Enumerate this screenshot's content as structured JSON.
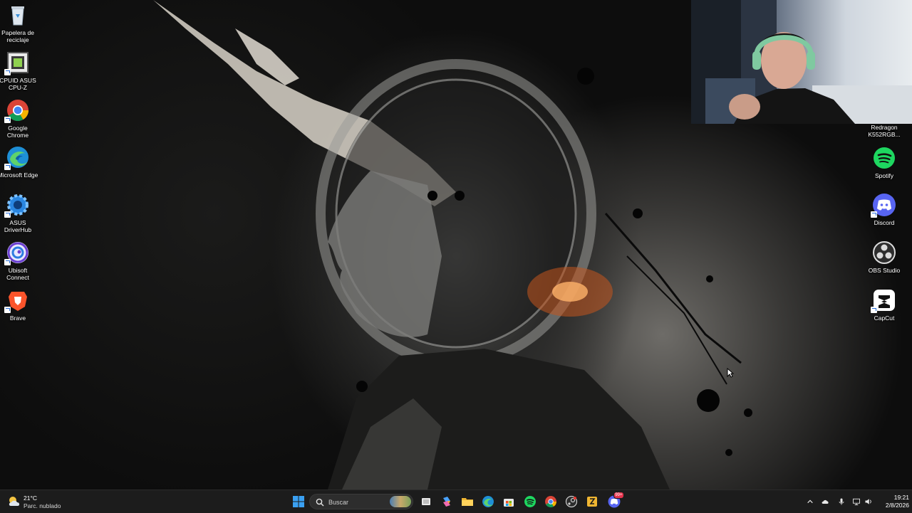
{
  "desktop": {
    "left_icons": [
      {
        "name": "recycle-bin",
        "label": "Papelera de reciclaje",
        "icon": "recycle-bin-icon"
      },
      {
        "name": "cpuz",
        "label": "CPUID ASUS CPU-Z",
        "icon": "cpuz-icon"
      },
      {
        "name": "chrome",
        "label": "Google Chrome",
        "icon": "chrome-icon"
      },
      {
        "name": "edge",
        "label": "Microsoft Edge",
        "icon": "edge-icon"
      },
      {
        "name": "asus-driverhub",
        "label": "ASUS DriverHub",
        "icon": "asus-gear-icon"
      },
      {
        "name": "ubisoft",
        "label": "Ubisoft Connect",
        "icon": "ubisoft-icon"
      },
      {
        "name": "brave",
        "label": "Brave",
        "icon": "brave-lion-icon"
      }
    ],
    "right_icons": [
      {
        "name": "redragon",
        "label": "Redragon K552RGB...",
        "icon": "keyboard-icon"
      },
      {
        "name": "spotify",
        "label": "Spotify",
        "icon": "spotify-icon"
      },
      {
        "name": "discord",
        "label": "Discord",
        "icon": "discord-icon"
      },
      {
        "name": "obs",
        "label": "OBS Studio",
        "icon": "obs-icon"
      },
      {
        "name": "capcut",
        "label": "CapCut",
        "icon": "capcut-icon"
      }
    ]
  },
  "taskbar": {
    "weather": {
      "temp": "21°C",
      "condition": "Parc. nublado",
      "icon": "partly-cloudy-icon"
    },
    "search": {
      "placeholder": "Buscar"
    },
    "pinned": [
      "windows-start-icon",
      "task-view-icon",
      "copilot-icon",
      "file-explorer-icon",
      "edge-icon",
      "microsoft-store-icon",
      "spotify-icon",
      "chrome-icon",
      "steam-icon",
      "capcut-icon",
      "discord-icon"
    ],
    "discord_badge": "99+",
    "tray": {
      "time": "19:21",
      "date": "2/8/2026"
    }
  },
  "colors": {
    "taskbar_bg": "#1c1c1c",
    "chrome_red": "#db4437",
    "chrome_green": "#0f9d58",
    "chrome_yellow": "#f4b400",
    "chrome_blue": "#4285f4",
    "spotify_green": "#1ed760",
    "discord_blurple": "#5865f2",
    "brave_orange": "#fb542b"
  }
}
